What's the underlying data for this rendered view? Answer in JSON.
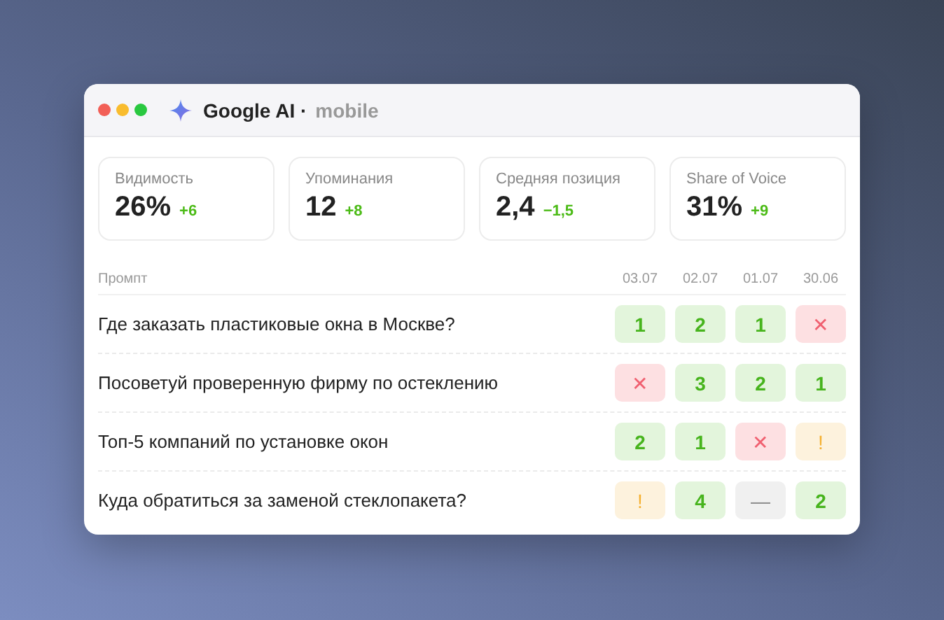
{
  "window": {
    "title": "Google AI ·",
    "subtitle": "mobile"
  },
  "metrics": [
    {
      "label": "Видимость",
      "value": "26%",
      "delta": "+6"
    },
    {
      "label": "Упоминания",
      "value": "12",
      "delta": "+8"
    },
    {
      "label": "Средняя позиция",
      "value": "2,4",
      "delta": "−1,5"
    },
    {
      "label": "Share of Voice",
      "value": "31%",
      "delta": "+9"
    }
  ],
  "table": {
    "columns": [
      "Промпт",
      "03.07",
      "02.07",
      "01.07",
      "30.06"
    ],
    "rows": [
      {
        "cells": [
          {
            "kind": "prompt",
            "text": "Где заказать пластиковые окна в Москве?"
          },
          {
            "kind": "rank",
            "text": "1"
          },
          {
            "kind": "rank",
            "text": "2"
          },
          {
            "kind": "rank",
            "text": "1"
          },
          {
            "kind": "miss",
            "text": "✕"
          }
        ]
      },
      {
        "cells": [
          {
            "kind": "prompt",
            "text": "Посоветуй проверенную фирму по остеклению"
          },
          {
            "kind": "miss",
            "text": "✕"
          },
          {
            "kind": "rank",
            "text": "3"
          },
          {
            "kind": "rank",
            "text": "2"
          },
          {
            "kind": "rank",
            "text": "1"
          }
        ]
      },
      {
        "cells": [
          {
            "kind": "prompt",
            "text": "Топ-5 компаний по установке окон"
          },
          {
            "kind": "rank",
            "text": "2"
          },
          {
            "kind": "rank",
            "text": "1"
          },
          {
            "kind": "miss",
            "text": "✕"
          },
          {
            "kind": "warn",
            "text": "!"
          }
        ]
      },
      {
        "cells": [
          {
            "kind": "prompt",
            "text": "Куда обратиться за заменой стеклопакета?"
          },
          {
            "kind": "warn",
            "text": "!"
          },
          {
            "kind": "rank",
            "text": "4"
          },
          {
            "kind": "none",
            "text": "—"
          },
          {
            "kind": "rank",
            "text": "2"
          }
        ]
      }
    ]
  }
}
